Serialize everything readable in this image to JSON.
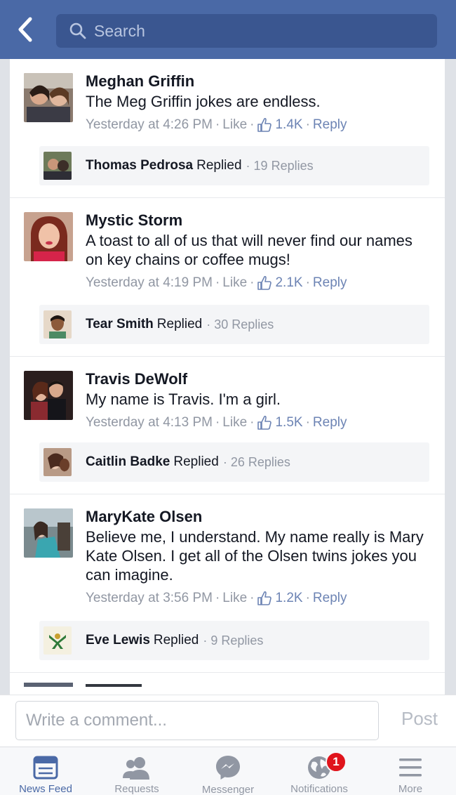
{
  "header": {
    "search_placeholder": "Search"
  },
  "comments": [
    {
      "name": "Meghan Griffin",
      "text": "The Meg Griffin jokes are endless.",
      "time": "Yesterday at 4:26 PM",
      "like_label": "Like",
      "likes": "1.4K",
      "reply_label": "Reply",
      "reply": {
        "name": "Thomas Pedrosa",
        "word": "Replied",
        "count": "19 Replies"
      }
    },
    {
      "name": "Mystic Storm",
      "text": "A toast to all of us that will never find our names on key chains or coffee mugs!",
      "time": "Yesterday at 4:19 PM",
      "like_label": "Like",
      "likes": "2.1K",
      "reply_label": "Reply",
      "reply": {
        "name": "Tear Smith",
        "word": "Replied",
        "count": "30 Replies"
      }
    },
    {
      "name": "Travis DeWolf",
      "text": "My name is Travis. I'm a girl.",
      "time": "Yesterday at 4:13 PM",
      "like_label": "Like",
      "likes": "1.5K",
      "reply_label": "Reply",
      "reply": {
        "name": "Caitlin Badke",
        "word": "Replied",
        "count": "26 Replies"
      }
    },
    {
      "name": "MaryKate Olsen",
      "text": "Believe me, I understand. My name really is Mary Kate Olsen. I get all of the Olsen twins jokes you can imagine.",
      "time": "Yesterday at 3:56 PM",
      "like_label": "Like",
      "likes": "1.2K",
      "reply_label": "Reply",
      "reply": {
        "name": "Eve Lewis",
        "word": "Replied",
        "count": "9 Replies"
      }
    }
  ],
  "composer": {
    "placeholder": "Write a comment...",
    "post_label": "Post"
  },
  "tabbar": {
    "tabs": [
      {
        "label": "News Feed",
        "icon": "news-feed-icon",
        "active": true
      },
      {
        "label": "Requests",
        "icon": "friend-requests-icon"
      },
      {
        "label": "Messenger",
        "icon": "messenger-icon"
      },
      {
        "label": "Notifications",
        "icon": "globe-icon",
        "badge": "1"
      },
      {
        "label": "More",
        "icon": "hamburger-menu-icon"
      }
    ]
  },
  "colors": {
    "brand": "#4a69a6",
    "link": "#6d84b4",
    "meta": "#9197a3",
    "badge": "#e0141c"
  }
}
